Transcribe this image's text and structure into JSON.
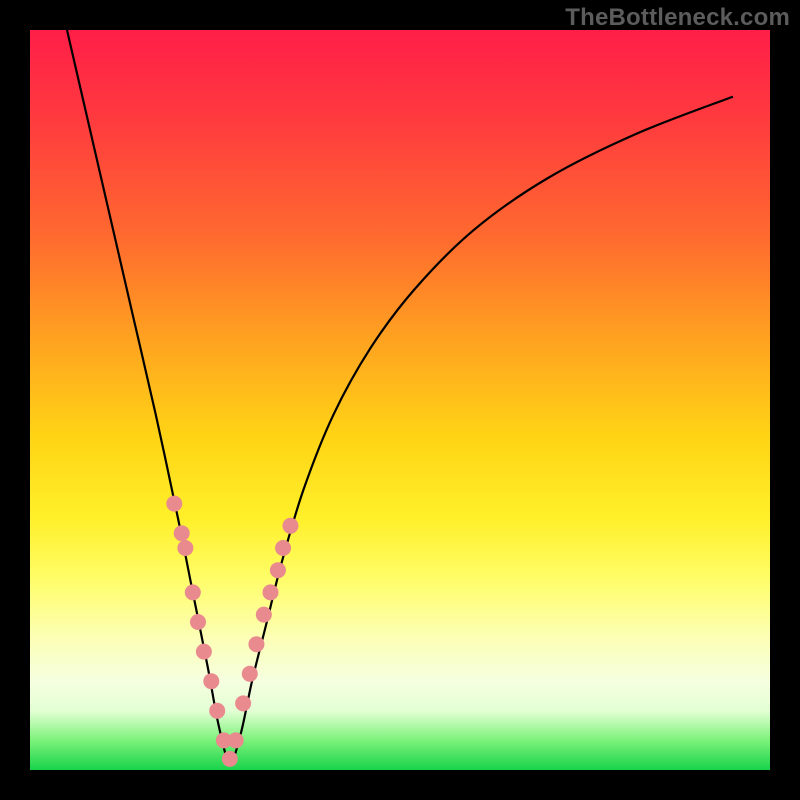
{
  "watermark": "TheBottleneck.com",
  "colors": {
    "frame": "#000000",
    "curve": "#000000",
    "dots": "#e98a8f",
    "gradient_top": "#ff1e48",
    "gradient_bottom": "#18d34b"
  },
  "chart_data": {
    "type": "line",
    "title": "",
    "xlabel": "",
    "ylabel": "",
    "xlim": [
      0,
      100
    ],
    "ylim": [
      0,
      100
    ],
    "description": "V-shaped bottleneck curve with minimum near x≈27. Background gradient red→yellow→green encodes severity (red=high bottleneck, green=optimal). Salmon dots mark highlighted configurations clustered around the trough and lower flanks.",
    "series": [
      {
        "name": "bottleneck-curve",
        "x": [
          5,
          8,
          11,
          14,
          17,
          20,
          22,
          24,
          25.5,
          27,
          28.5,
          30,
          32,
          34,
          37,
          41,
          46,
          52,
          60,
          70,
          82,
          95
        ],
        "y": [
          100,
          87,
          74,
          61,
          48,
          34,
          24,
          14,
          6,
          1,
          5,
          12,
          20,
          28,
          38,
          48,
          57,
          65,
          73,
          80,
          86,
          91
        ]
      }
    ],
    "highlight_points": {
      "name": "config-dots",
      "x": [
        19.5,
        20.5,
        21.0,
        22.0,
        22.7,
        23.5,
        24.5,
        25.3,
        26.2,
        27.0,
        27.8,
        28.8,
        29.7,
        30.6,
        31.6,
        32.5,
        33.5,
        34.2,
        35.2
      ],
      "y": [
        36,
        32,
        30,
        24,
        20,
        16,
        12,
        8,
        4,
        1.5,
        4,
        9,
        13,
        17,
        21,
        24,
        27,
        30,
        33
      ]
    }
  }
}
